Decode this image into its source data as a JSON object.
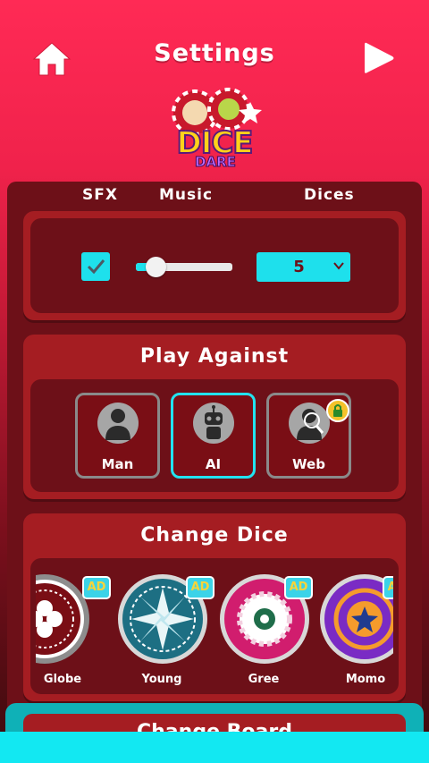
{
  "header": {
    "title": "Settings"
  },
  "logo": {
    "main": "DICE",
    "sub": "DARE"
  },
  "settings": {
    "sfx_label": "SFX",
    "music_label": "Music",
    "dices_label": "Dices",
    "sfx_checked": true,
    "music_volume": 0.2,
    "dices_value": "5"
  },
  "play_against": {
    "title": "Play Against",
    "options": [
      {
        "label": "Man",
        "selected": false,
        "locked": false
      },
      {
        "label": "AI",
        "selected": true,
        "locked": false
      },
      {
        "label": "Web",
        "selected": false,
        "locked": true
      }
    ]
  },
  "change_dice": {
    "title": "Change Dice",
    "ad_badge": "AD",
    "items": [
      {
        "label": "Globe",
        "color": "#7a0e15"
      },
      {
        "label": "Young",
        "color": "#1d6f83"
      },
      {
        "label": "Gree",
        "color": "#d11d6e"
      },
      {
        "label": "Momo",
        "color": "#7a2bc4"
      }
    ]
  },
  "next_section": {
    "title": "Change Board"
  },
  "colors": {
    "accent": "#1ee0ec",
    "card": "#a51d22",
    "panel": "#6d1018"
  }
}
